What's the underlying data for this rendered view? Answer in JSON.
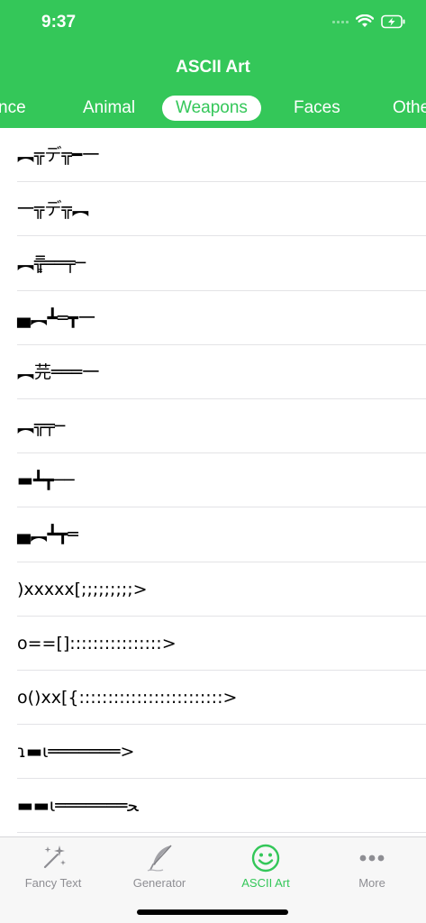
{
  "status": {
    "time": "9:37"
  },
  "header": {
    "title": "ASCII Art"
  },
  "tabs": [
    {
      "label": "Romance"
    },
    {
      "label": "Animal"
    },
    {
      "label": "Weapons",
      "active": true
    },
    {
      "label": "Faces"
    },
    {
      "label": "Other"
    }
  ],
  "items": [
    "︻╦デ╦━一",
    "一╦デ╦︻",
    "︻╦̵̵͇̿̿̿̿══╤─",
    "▄︻┻═┳一",
    "︻芫═══一",
    "︻╦╤─",
    "▬┻┳──",
    "▄︻┻┳═",
    ")xxxxx[;;;;;;;;;>",
    "o==[]::::::::::::::::>",
    "o()xx[{:::::::::::::::::::::::::>",
    "ɿ▬ɩ═══════>",
    "▬▬ι═══════ﺤ"
  ],
  "tabbar": [
    {
      "label": "Fancy Text",
      "icon": "sparkles-icon"
    },
    {
      "label": "Generator",
      "icon": "quill-icon"
    },
    {
      "label": "ASCII Art",
      "icon": "smiley-icon",
      "active": true
    },
    {
      "label": "More",
      "icon": "ellipsis-icon"
    }
  ],
  "colors": {
    "accent": "#34c759",
    "inactive": "#8e8e93"
  }
}
